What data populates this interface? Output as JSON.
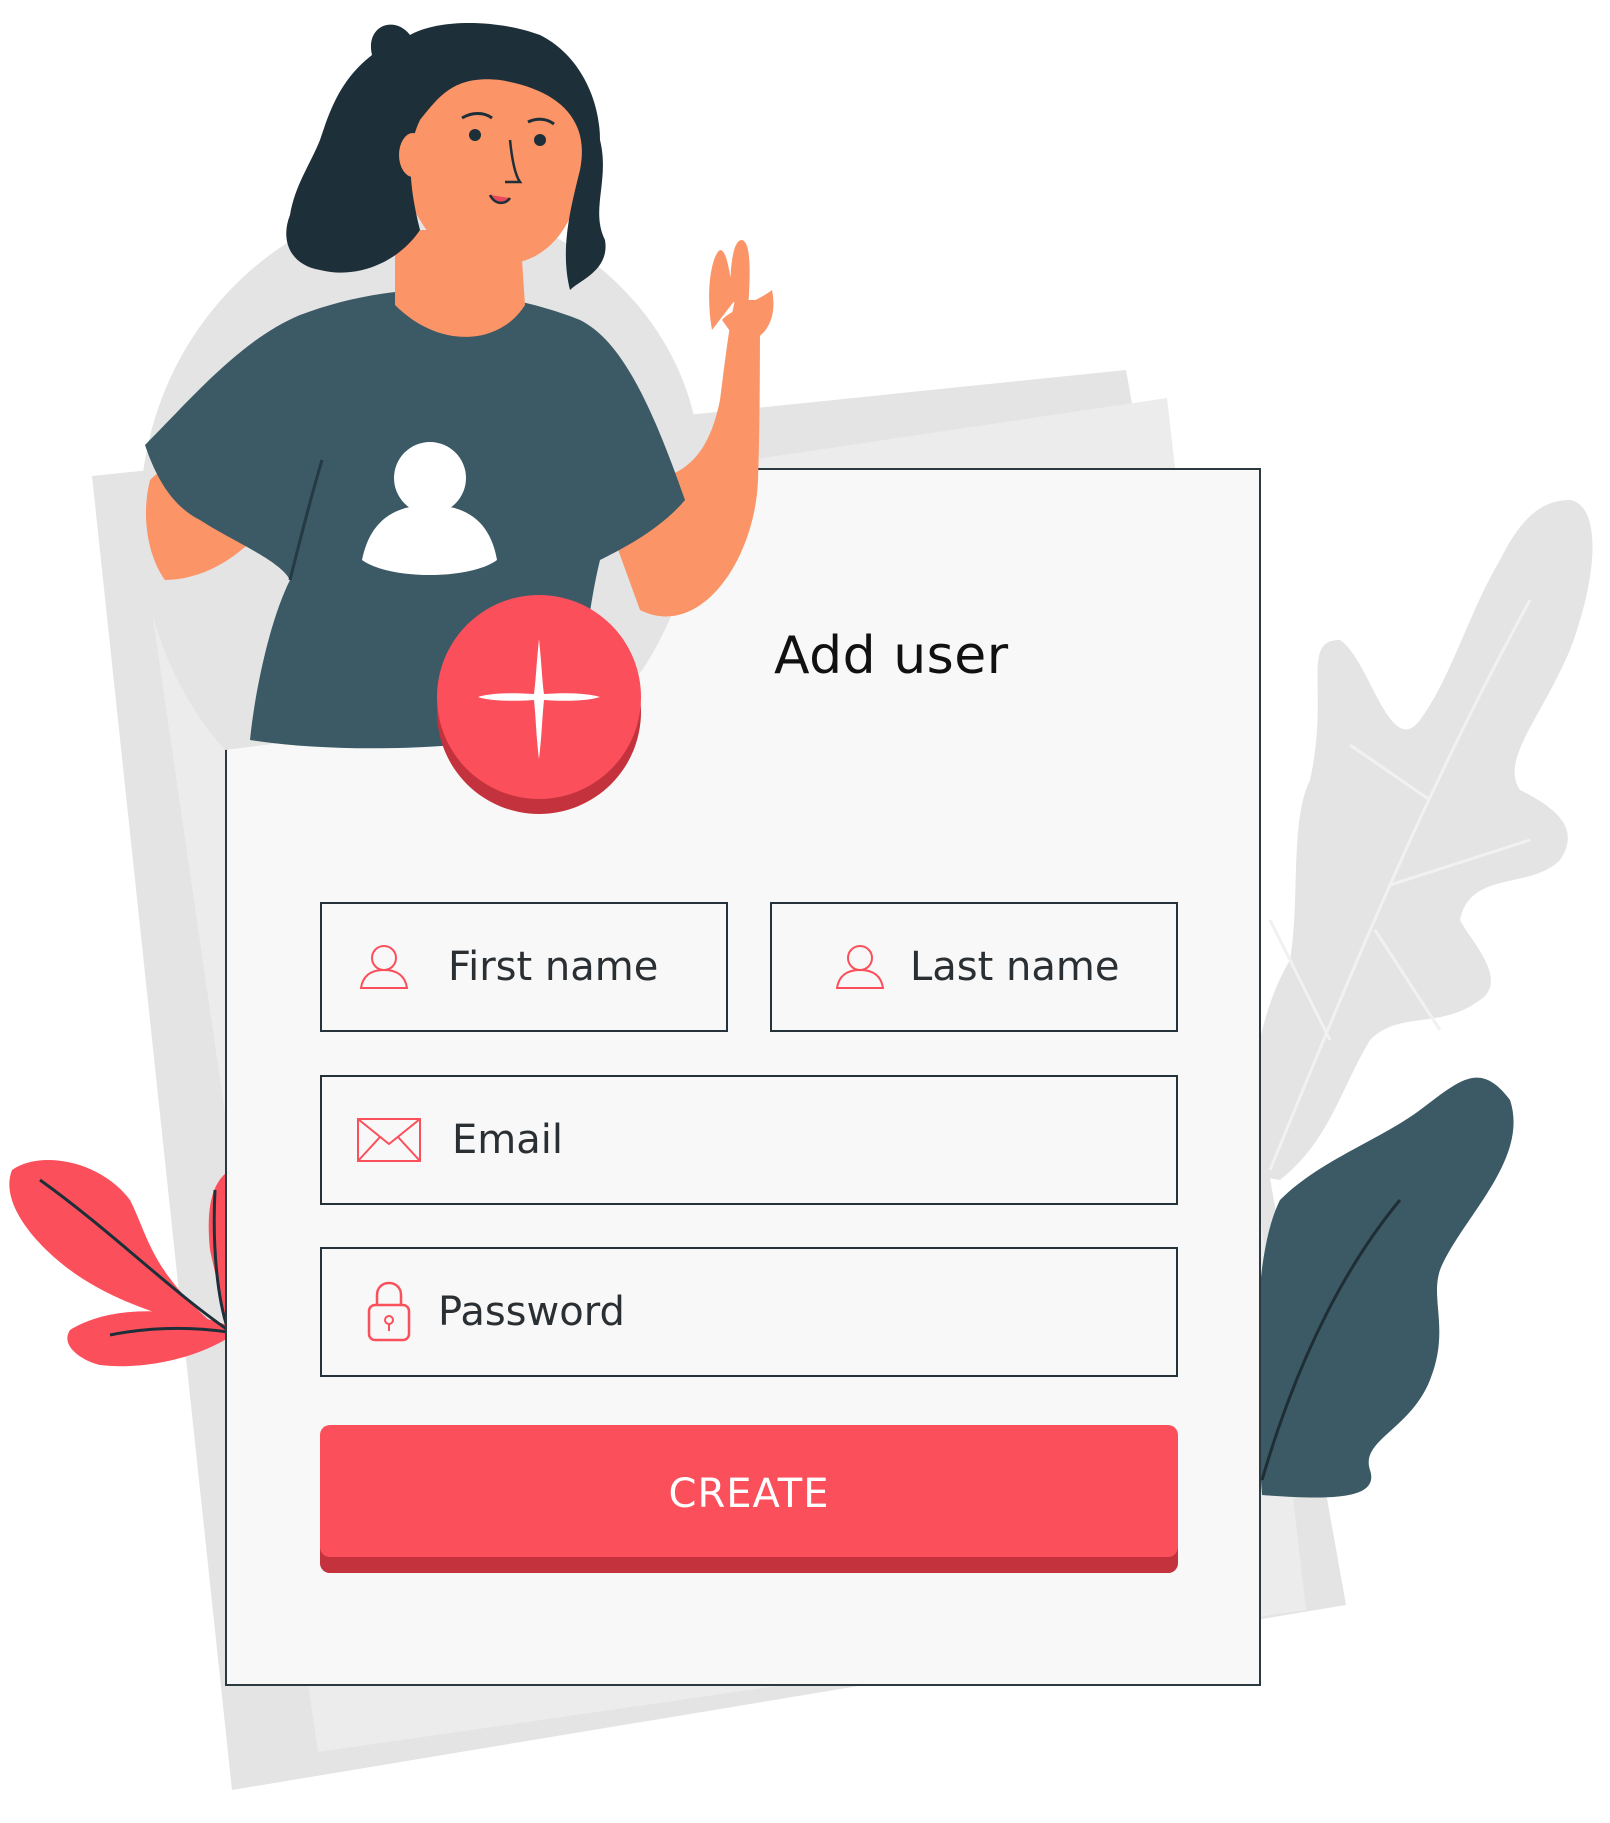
{
  "form": {
    "title": "Add user",
    "fields": {
      "first_name": {
        "label": "First name",
        "icon": "user-icon"
      },
      "last_name": {
        "label": "Last name",
        "icon": "user-icon"
      },
      "email": {
        "label": "Email",
        "icon": "envelope-icon"
      },
      "password": {
        "label": "Password",
        "icon": "lock-icon"
      }
    },
    "submit_label": "CREATE",
    "add_icon": "plus-icon"
  },
  "colors": {
    "accent": "#fb505b",
    "accent_dark": "#c4333d",
    "shirt": "#3b5a66",
    "skin": "#fb9467",
    "hair": "#1d2f38",
    "paper_gray": "#e4e4e4",
    "card_bg": "#f8f8f8"
  }
}
